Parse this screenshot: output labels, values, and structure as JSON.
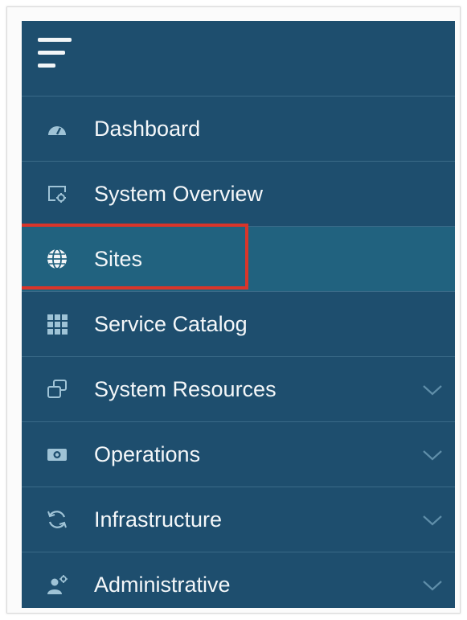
{
  "menu": {
    "items": [
      {
        "label": "Dashboard",
        "icon": "dashboard-gauge-icon",
        "has_submenu": false,
        "active": false
      },
      {
        "label": "System Overview",
        "icon": "system-overview-icon",
        "has_submenu": false,
        "active": false
      },
      {
        "label": "Sites",
        "icon": "globe-icon",
        "has_submenu": false,
        "active": true
      },
      {
        "label": "Service Catalog",
        "icon": "grid-icon",
        "has_submenu": false,
        "active": false
      },
      {
        "label": "System Resources",
        "icon": "stacked-windows-icon",
        "has_submenu": true,
        "active": false
      },
      {
        "label": "Operations",
        "icon": "camera-icon",
        "has_submenu": true,
        "active": false
      },
      {
        "label": "Infrastructure",
        "icon": "refresh-icon",
        "has_submenu": true,
        "active": false
      },
      {
        "label": "Administrative",
        "icon": "user-gear-icon",
        "has_submenu": true,
        "active": false
      }
    ]
  },
  "colors": {
    "nav_background": "#1e4e6e",
    "active_background": "#21627f",
    "divider": "#3a6a88",
    "text": "#f4f7f9",
    "icon": "#9fc3d6",
    "highlight": "#d9352a"
  }
}
